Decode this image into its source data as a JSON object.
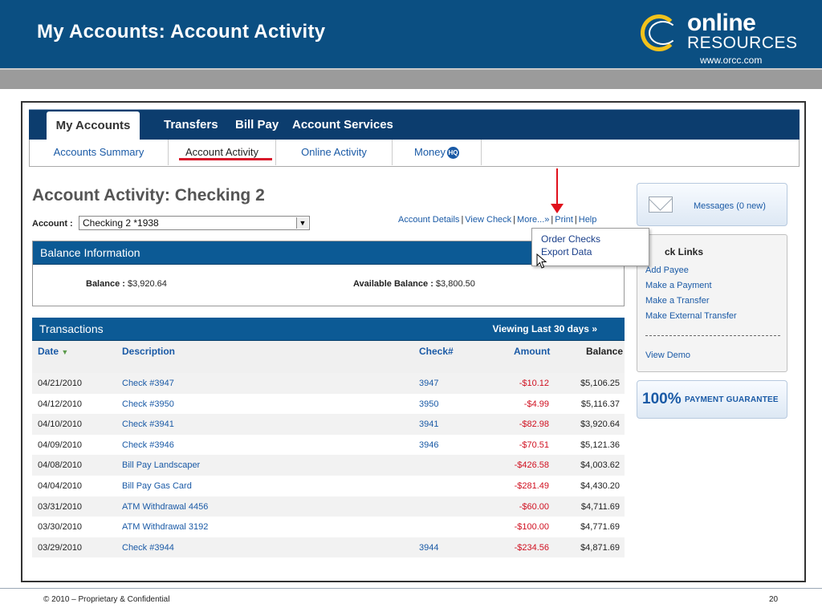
{
  "slide": {
    "title": "My Accounts: Account Activity",
    "logo_online": "online",
    "logo_resources": "RESOURCES",
    "logo_url": "www.orcc.com",
    "brand_color": "#0b4f82",
    "accent_color": "#f2c21b",
    "footer_left": "© 2010 – Proprietary & Confidential",
    "footer_page": "20"
  },
  "topnav": {
    "items": [
      "My Accounts",
      "Transfers",
      "Bill Pay",
      "Account Services"
    ]
  },
  "subnav": {
    "items": [
      "Accounts Summary",
      "Account Activity",
      "Online Activity",
      "Money"
    ],
    "money_badge": "HQ"
  },
  "page": {
    "heading": "Account Activity: Checking 2",
    "account_label": "Account :",
    "account_value": "Checking 2 *1938",
    "links": [
      "Account Details",
      "View Check",
      "More...»",
      "Print",
      "Help"
    ]
  },
  "more_menu": {
    "items": [
      "Order Checks",
      "Export Data"
    ]
  },
  "balance": {
    "title": "Balance Information",
    "balance_label": "Balance :",
    "balance_value": "$3,920.64",
    "available_label": "Available Balance :",
    "available_value": "$3,800.50"
  },
  "transactions": {
    "title": "Transactions",
    "viewing": "Viewing Last 30 days »",
    "columns": [
      "Date",
      "Description",
      "Check#",
      "Amount",
      "Balance"
    ],
    "sort_icon": "sort-down-arrow",
    "rows": [
      {
        "date": "04/21/2010",
        "desc": "Check #3947",
        "check": "3947",
        "amount": "-$10.12",
        "balance": "$5,106.25"
      },
      {
        "date": "04/12/2010",
        "desc": "Check #3950",
        "check": "3950",
        "amount": "-$4.99",
        "balance": "$5,116.37"
      },
      {
        "date": "04/10/2010",
        "desc": "Check #3941",
        "check": "3941",
        "amount": "-$82.98",
        "balance": "$3,920.64"
      },
      {
        "date": "04/09/2010",
        "desc": "Check #3946",
        "check": "3946",
        "amount": "-$70.51",
        "balance": "$5,121.36"
      },
      {
        "date": "04/08/2010",
        "desc": "Bill Pay Landscaper",
        "check": "",
        "amount": "-$426.58",
        "balance": "$4,003.62"
      },
      {
        "date": "04/04/2010",
        "desc": "Bill Pay Gas Card",
        "check": "",
        "amount": "-$281.49",
        "balance": "$4,430.20"
      },
      {
        "date": "03/31/2010",
        "desc": "ATM Withdrawal 4456",
        "check": "",
        "amount": "-$60.00",
        "balance": "$4,711.69"
      },
      {
        "date": "03/30/2010",
        "desc": "ATM Withdrawal 3192",
        "check": "",
        "amount": "-$100.00",
        "balance": "$4,771.69"
      },
      {
        "date": "03/29/2010",
        "desc": "Check #3944",
        "check": "3944",
        "amount": "-$234.56",
        "balance": "$4,871.69"
      }
    ]
  },
  "sidebar": {
    "messages": "Messages (0 new)",
    "quick_links_title": "ck Links",
    "quick_links": [
      "Add Payee",
      "Make a Payment",
      "Make a Transfer",
      "Make External Transfer"
    ],
    "view_demo": "View Demo",
    "guarantee_big": "100%",
    "guarantee_small": "PAYMENT GUARANTEE"
  }
}
